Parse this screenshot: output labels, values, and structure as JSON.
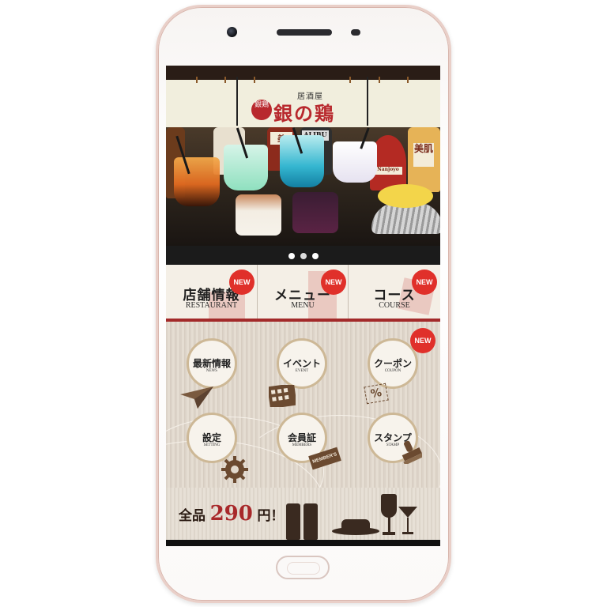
{
  "app": {
    "logo_badge": "銀鶏",
    "logo_subtitle": "居酒屋",
    "logo_title": "銀の鶏"
  },
  "hero": {
    "bottle_labels": [
      "美肌",
      "美",
      "Nanjoyo",
      "ALIBU"
    ],
    "slide_count": 3
  },
  "categories": [
    {
      "label": "店舗情報",
      "sub": "RESTAURANT",
      "badge": "NEW"
    },
    {
      "label": "メニュー",
      "sub": "MENU",
      "badge": "NEW"
    },
    {
      "label": "コース",
      "sub": "COURSE",
      "badge": "NEW"
    }
  ],
  "menu_buttons": [
    {
      "label": "最新情報",
      "sub": "NEWS"
    },
    {
      "label": "イベント",
      "sub": "EVENT"
    },
    {
      "label": "クーポン",
      "sub": "COUPON",
      "badge": "NEW",
      "icon_text": "%"
    },
    {
      "label": "設定",
      "sub": "SETTING"
    },
    {
      "label": "会員証",
      "sub": "MEMBERS",
      "card_text": "MEMBER'S"
    },
    {
      "label": "スタンプ",
      "sub": "STAMP"
    }
  ],
  "promo": {
    "prefix": "全品",
    "price": "290",
    "suffix": "円！"
  },
  "colors": {
    "accent_red": "#e0302a",
    "brand_red": "#b8282d",
    "badge_text": "#ffffff"
  }
}
